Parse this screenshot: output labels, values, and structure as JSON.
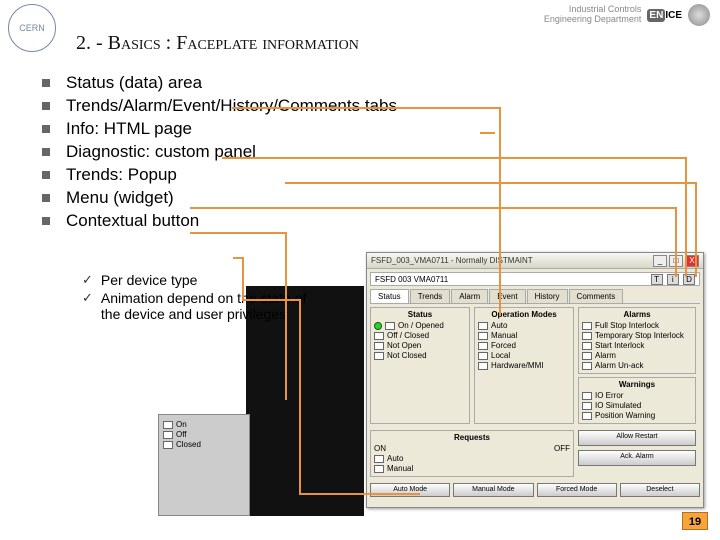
{
  "header": {
    "dept_line1": "Industrial Controls",
    "dept_line2": "Engineering Department",
    "badge_en": "EN",
    "badge_ice": "ICE"
  },
  "logo": "CERN",
  "title": "2. - Basics : Faceplate information",
  "bullets": [
    "Status (data) area",
    "Trends/Alarm/Event/History/Comments tabs",
    "Info: HTML page",
    "Diagnostic: custom panel",
    "Trends: Popup",
    "Menu (widget)",
    "Contextual button"
  ],
  "subbullets": [
    "Per device type",
    "Animation depend on the state of the device and user privileges"
  ],
  "popup": {
    "title": "FSFD_003_VMA0711 - Normally DISTMAINT",
    "crumb": "FSFD 003 VMA0711",
    "btn_t": "T",
    "btn_i": "i",
    "btn_d": "D",
    "win_min": "_",
    "win_max": "□",
    "win_close": "X",
    "tabs": [
      "Status",
      "Trends",
      "Alarm",
      "Event",
      "History",
      "Comments"
    ],
    "group_status": {
      "title": "Status",
      "items": [
        "On / Opened",
        "Off / Closed",
        "Not Open",
        "Not Closed"
      ]
    },
    "group_modes": {
      "title": "Operation Modes",
      "items": [
        "Auto",
        "Manual",
        "Forced",
        "Local",
        "Hardware/MMI"
      ]
    },
    "group_alarms": {
      "title": "Alarms",
      "items": [
        "Full Stop Interlock",
        "Temporary Stop Interlock",
        "Start Interlock",
        "Alarm",
        "Alarm Un-ack"
      ]
    },
    "group_warnings": {
      "title": "Warnings",
      "items": [
        "IO Error",
        "IO Simulated",
        "Position Warning"
      ]
    },
    "group_req": {
      "title": "Requests",
      "on": "ON",
      "off": "OFF",
      "items": [
        "Auto",
        "Manual"
      ]
    },
    "allow": "Allow Restart",
    "ack": "Ack. Alarm",
    "btns": [
      "Auto Mode",
      "Manual Mode",
      "Forced Mode",
      "Deselect"
    ]
  },
  "page": "19",
  "minipanel": {
    "on": "On",
    "off": "Off",
    "cl": "Closed"
  }
}
